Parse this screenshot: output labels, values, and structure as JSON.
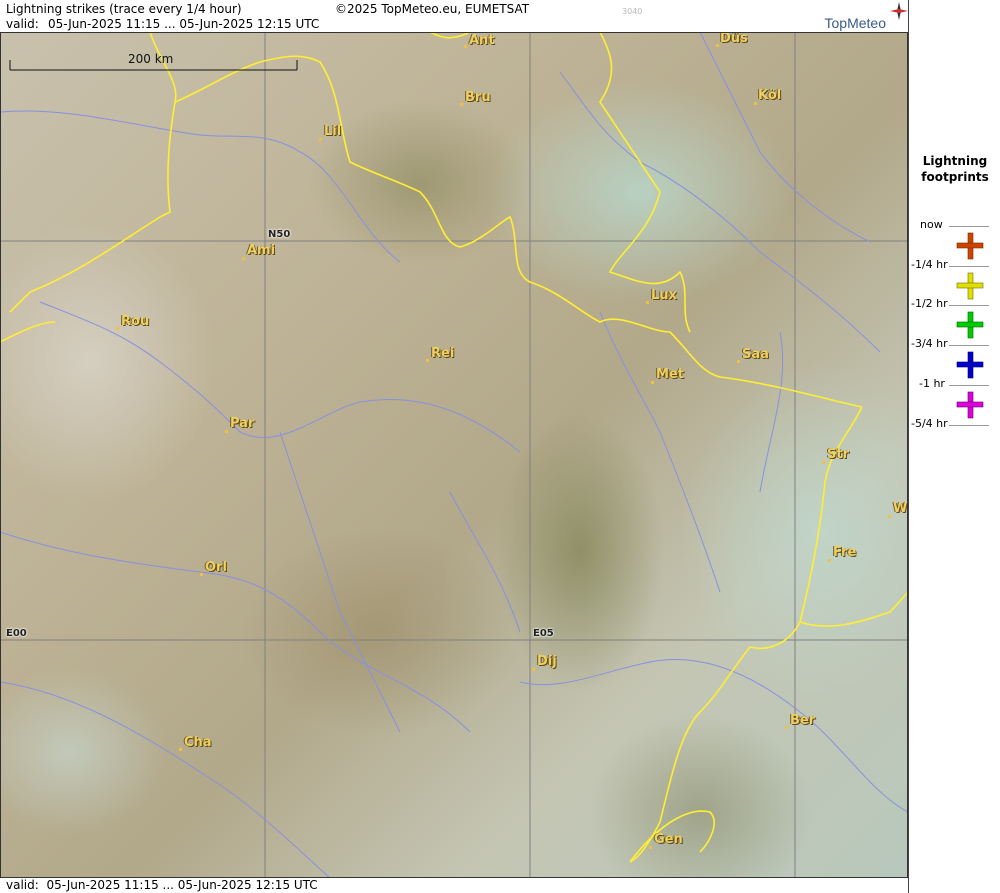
{
  "header": {
    "title": "Lightning strikes (trace every 1/4 hour)",
    "copyright": "©2025 TopMeteo.eu, EUMETSAT",
    "code": "3040",
    "valid_label": "valid:",
    "valid_range": "05-Jun-2025 11:15 ... 05-Jun-2025 12:15 UTC",
    "logo": "TopMeteo"
  },
  "map": {
    "scale_label": "200 km",
    "grid_labels": {
      "lat50": "N50",
      "lon00": "E00",
      "lon05": "E05"
    },
    "cities": [
      {
        "name": "Ant"
      },
      {
        "name": "Düs"
      },
      {
        "name": "Bru"
      },
      {
        "name": "Köl"
      },
      {
        "name": "Lil"
      },
      {
        "name": "Ami"
      },
      {
        "name": "Rou"
      },
      {
        "name": "Lux"
      },
      {
        "name": "Rei"
      },
      {
        "name": "Saa"
      },
      {
        "name": "Met"
      },
      {
        "name": "Par"
      },
      {
        "name": "Str"
      },
      {
        "name": "W"
      },
      {
        "name": "Fre"
      },
      {
        "name": "Orl"
      },
      {
        "name": "Dij"
      },
      {
        "name": "Ber"
      },
      {
        "name": "Cha"
      },
      {
        "name": "Gen"
      }
    ]
  },
  "legend": {
    "title_line1": "Lightning",
    "title_line2": "footprints",
    "items": [
      {
        "label": "now"
      },
      {
        "label": "-1/4 hr",
        "color": "#cc4400"
      },
      {
        "label": "-1/2 hr",
        "color": "#e0e000"
      },
      {
        "label": "-3/4 hr",
        "color": "#00cc00"
      },
      {
        "label": "-1 hr",
        "color": "#0000cc"
      },
      {
        "label": "-5/4 hr",
        "color": "#dd00dd"
      }
    ]
  },
  "colors": {
    "border": "#ffee33",
    "river": "#8890e0",
    "grid": "#808080",
    "city_text": "#f0d060"
  }
}
